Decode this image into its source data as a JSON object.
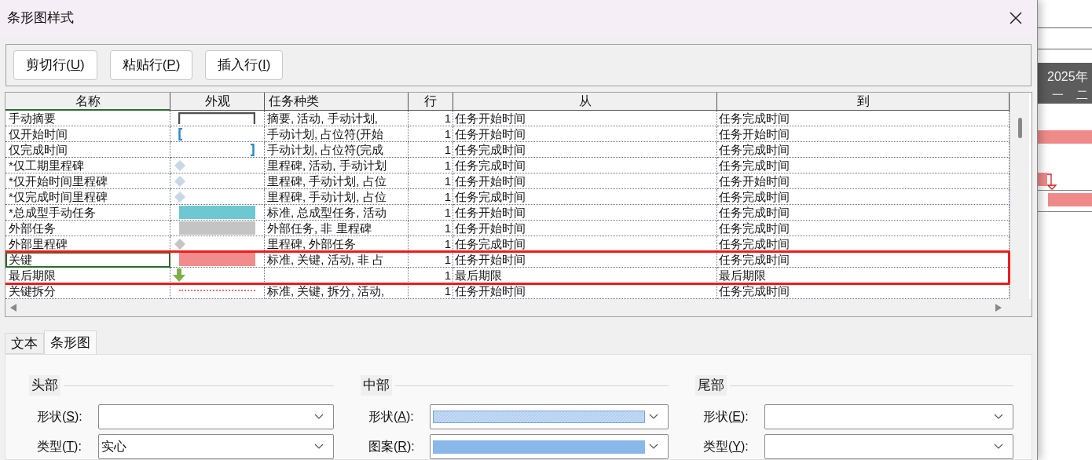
{
  "window": {
    "title": "条形图样式"
  },
  "toolbar": [
    {
      "before": "剪切行(",
      "accelerator": "U",
      "after": ")"
    },
    {
      "before": "粘贴行(",
      "accelerator": "P",
      "after": ")"
    },
    {
      "before": "插入行(",
      "accelerator": "I",
      "after": ")"
    }
  ],
  "table": {
    "columns": [
      "名称",
      "外观",
      "任务种类",
      "行",
      "从",
      "到"
    ],
    "rows": [
      {
        "name": "手动摘要",
        "appearance": {
          "kind": "summary-bracket",
          "color": "#505050"
        },
        "task_type": "摘要, 活动, 手动计划,",
        "row": "1",
        "from": "任务开始时间",
        "to": "任务完成时间",
        "selected": false,
        "highlighted": false
      },
      {
        "name": "仅开始时间",
        "appearance": {
          "kind": "start-bracket",
          "color": "#2e8bc7"
        },
        "task_type": "手动计划, 占位符(开始",
        "row": "1",
        "from": "任务开始时间",
        "to": "任务开始时间",
        "selected": false,
        "highlighted": false
      },
      {
        "name": "仅完成时间",
        "appearance": {
          "kind": "end-bracket",
          "color": "#2e8bc7"
        },
        "task_type": "手动计划, 占位符(完成",
        "row": "1",
        "from": "任务完成时间",
        "to": "任务完成时间",
        "selected": false,
        "highlighted": false
      },
      {
        "name": "*仅工期里程碑",
        "appearance": {
          "kind": "diamond",
          "color": "#c9d6e6"
        },
        "task_type": "里程碑, 活动, 手动计划",
        "row": "1",
        "from": "任务完成时间",
        "to": "任务完成时间",
        "selected": false,
        "highlighted": false
      },
      {
        "name": "*仅开始时间里程碑",
        "appearance": {
          "kind": "diamond",
          "color": "#c9d6e6"
        },
        "task_type": "里程碑, 手动计划, 占位",
        "row": "1",
        "from": "任务开始时间",
        "to": "任务开始时间",
        "selected": false,
        "highlighted": false
      },
      {
        "name": "*仅完成时间里程碑",
        "appearance": {
          "kind": "diamond",
          "color": "#c9d6e6"
        },
        "task_type": "里程碑, 手动计划, 占位",
        "row": "1",
        "from": "任务完成时间",
        "to": "任务完成时间",
        "selected": false,
        "highlighted": false
      },
      {
        "name": "*总成型手动任务",
        "appearance": {
          "kind": "bar",
          "color": "#6ec8d2"
        },
        "task_type": "标准, 总成型任务, 活动",
        "row": "1",
        "from": "任务开始时间",
        "to": "任务完成时间",
        "selected": false,
        "highlighted": false
      },
      {
        "name": "外部任务",
        "appearance": {
          "kind": "bar",
          "color": "#c4c4c4"
        },
        "task_type": "外部任务, 非  里程碑",
        "row": "1",
        "from": "任务开始时间",
        "to": "任务完成时间",
        "selected": false,
        "highlighted": false
      },
      {
        "name": "外部里程碑",
        "appearance": {
          "kind": "diamond",
          "color": "#c4c4c4"
        },
        "task_type": "里程碑, 外部任务",
        "row": "1",
        "from": "任务完成时间",
        "to": "任务完成时间",
        "selected": false,
        "highlighted": false
      },
      {
        "name": "关键",
        "appearance": {
          "kind": "bar",
          "color": "#f28b8b"
        },
        "task_type": "标准, 关键, 活动, 非  占",
        "row": "1",
        "from": "任务开始时间",
        "to": "任务完成时间",
        "selected": true,
        "highlighted": true
      },
      {
        "name": "最后期限",
        "appearance": {
          "kind": "deadline-arrow",
          "color": "#7db04a"
        },
        "row": "1",
        "from": "最后期限",
        "to": "最后期限",
        "selected": false,
        "highlighted": true
      },
      {
        "name": "关键拆分",
        "appearance": {
          "kind": "dotted-line",
          "color": "#f07070"
        },
        "task_type": "标准, 关键, 拆分, 活动,",
        "row": "1",
        "from": "任务开始时间",
        "to": "任务完成时间",
        "selected": false,
        "highlighted": false
      }
    ]
  },
  "tabs": [
    {
      "label": "文本",
      "selected": false
    },
    {
      "label": "条形图",
      "selected": true
    }
  ],
  "groups": [
    {
      "title": "头部",
      "fields": [
        {
          "before": "形状(",
          "accelerator": "S",
          "after": "):"
        },
        {
          "before": "类型(",
          "accelerator": "T",
          "after": "):",
          "value": "实心"
        }
      ]
    },
    {
      "title": "中部",
      "fields": [
        {
          "before": "形状(",
          "accelerator": "A",
          "after": "):",
          "swatch": {
            "color": "#b5d0f0",
            "kind": "hatched"
          }
        },
        {
          "before": "图案(",
          "accelerator": "R",
          "after": "):",
          "swatch": {
            "color": "#8ab8ea",
            "kind": "solid"
          }
        }
      ]
    },
    {
      "title": "尾部",
      "fields": [
        {
          "before": "形状(",
          "accelerator": "E",
          "after": "):"
        },
        {
          "before": "类型(",
          "accelerator": "Y",
          "after": "):"
        }
      ]
    }
  ],
  "background": {
    "year": "2025年",
    "days": [
      "一",
      "二"
    ]
  }
}
